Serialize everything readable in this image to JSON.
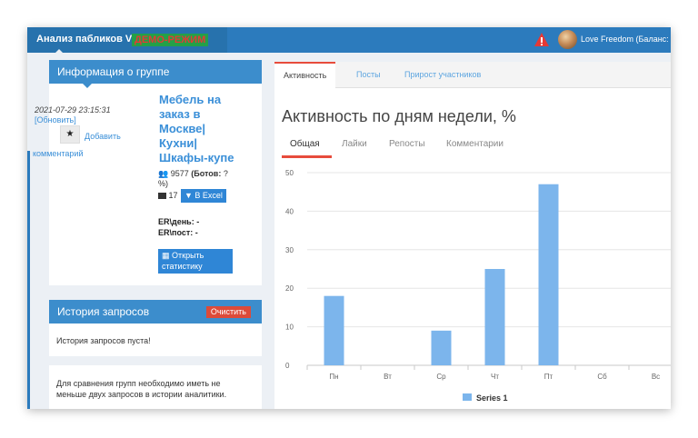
{
  "header": {
    "app_title": "Анализ пабликов VK",
    "mode_badge": "ДЕМО-РЕЖИМ",
    "user_text": "Love Freedom (Баланс: ("
  },
  "info_panel": {
    "title": "Информация о группе",
    "date": "2021-07-29 23:15:31",
    "refresh_link": "[Обновить]",
    "add_comment": "Добавить",
    "comment_word": "комментарий",
    "group_name": "Мебель на заказ в Москве| Кухни| Шкафы-купе",
    "members_count": "9577",
    "bots_label": "(Ботов:",
    "bots_value": "?",
    "bots_close": "%)",
    "posts_count": "17",
    "excel_button": "В Excel",
    "er_day": "ER\\день: -",
    "er_post": "ER\\пост: -",
    "open_stats_button": "Открыть статистику"
  },
  "history_panel": {
    "title": "История запросов",
    "clear_button": "Очистить",
    "empty_text": "История запросов пуста!"
  },
  "compare_panel": {
    "text": "Для сравнения групп необходимо иметь не меньше двух запросов в истории аналитики."
  },
  "main_tabs": [
    {
      "label": "Активность",
      "active": true
    },
    {
      "label": "Посты",
      "active": false
    },
    {
      "label": "Прирост участников",
      "active": false
    }
  ],
  "chart_heading": "Активность по дням недели, %",
  "sub_tabs": [
    {
      "label": "Общая",
      "active": true
    },
    {
      "label": "Лайки",
      "active": false
    },
    {
      "label": "Репосты",
      "active": false
    },
    {
      "label": "Комментарии",
      "active": false
    }
  ],
  "colors": {
    "header_blue": "#2c7bbd",
    "panel_head_blue": "#3c8dcc",
    "accent_red": "#e74c3c",
    "bar_blue": "#7cb5ec",
    "link_blue": "#3a8fd8"
  },
  "icons": [
    "warning-icon",
    "user-avatar",
    "star-icon",
    "users-icon",
    "posts-icon",
    "vk-icon",
    "bar-chart-icon"
  ],
  "chart_data": {
    "type": "bar",
    "categories": [
      "Пн",
      "Вт",
      "Ср",
      "Чт",
      "Пт",
      "Сб",
      "Вс"
    ],
    "series": [
      {
        "name": "Series 1",
        "values": [
          18,
          0,
          9,
          25,
          47,
          0,
          0
        ]
      }
    ],
    "ylim": [
      0,
      50
    ],
    "yticks": [
      0,
      10,
      20,
      30,
      40,
      50
    ],
    "grid": true,
    "legend": "bottom"
  }
}
